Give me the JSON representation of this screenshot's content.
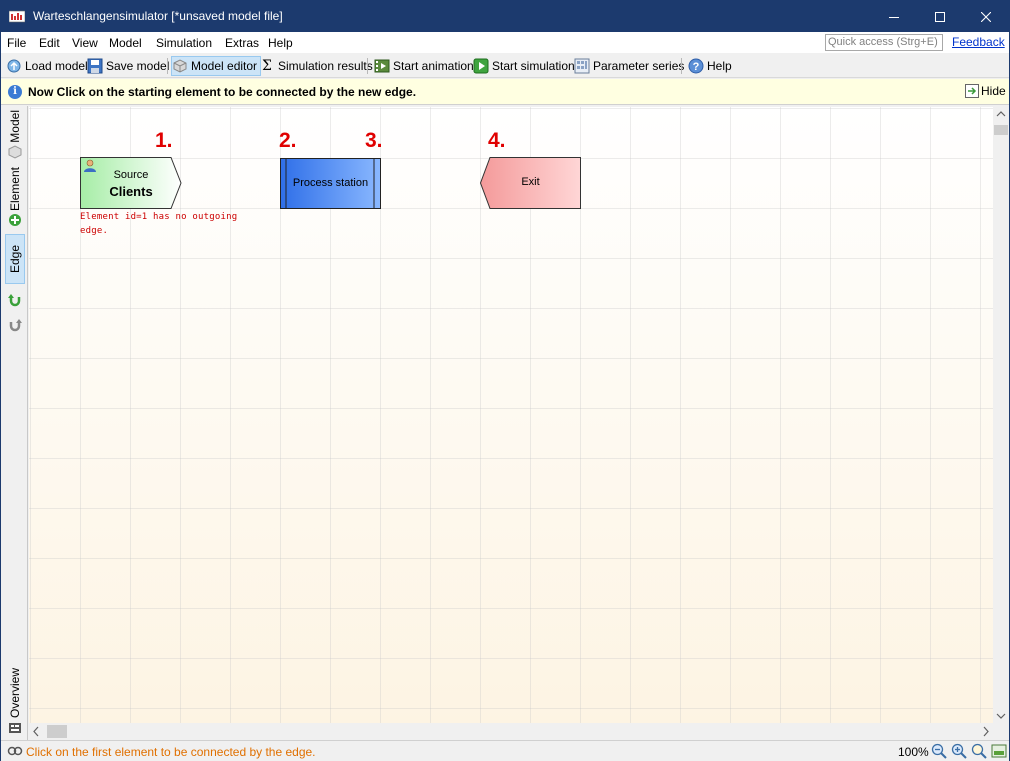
{
  "window": {
    "title": "Warteschlangensimulator [*unsaved model file]"
  },
  "menu": {
    "items": [
      "File",
      "Edit",
      "View",
      "Model",
      "Simulation",
      "Extras",
      "Help"
    ],
    "quick_access_placeholder": "Quick access (Strg+E)",
    "feedback": "Feedback"
  },
  "toolbar": {
    "load_model": "Load model",
    "save_model": "Save model",
    "model_editor": "Model editor",
    "simulation_results": "Simulation results",
    "start_animation": "Start animation",
    "start_simulation": "Start simulation",
    "parameter_series": "Parameter series",
    "help": "Help"
  },
  "infobar": {
    "message": "Now Click on the starting element to be connected by the new edge.",
    "hide": "Hide"
  },
  "sidebar": {
    "model": "Model",
    "element": "Element",
    "edge": "Edge",
    "overview": "Overview"
  },
  "canvas": {
    "steps": [
      "1.",
      "2.",
      "3.",
      "4."
    ],
    "source": {
      "type_label": "Source",
      "name": "Clients",
      "color": "#b8f0b8"
    },
    "process": {
      "label": "Process station",
      "color": "#3a7ff0"
    },
    "exit": {
      "label": "Exit",
      "color": "#f6a0a0"
    },
    "warning": "Element id=1 has no outgoing edge."
  },
  "status": {
    "message": "Click on the first element to be connected by the edge.",
    "zoom": "100%"
  },
  "colors": {
    "titlebar": "#1c3a6e",
    "step_numbers": "#e00000",
    "status_text": "#e07000",
    "warning": "#cc0000"
  }
}
